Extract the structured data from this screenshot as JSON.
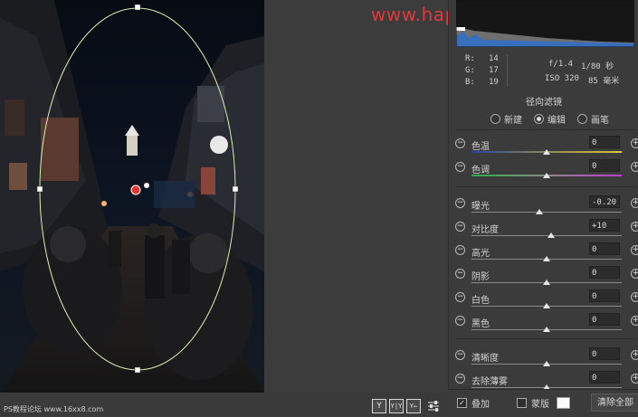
{
  "watermark": "www.happyjiansheji.com",
  "corner_watermark": "PS教程论坛 www.16xx8.com",
  "readout": {
    "r_label": "R:",
    "r_value": "14",
    "g_label": "G:",
    "g_value": "17",
    "b_label": "B:",
    "b_value": "19",
    "aperture": "f/1.4",
    "shutter": "1/80 秒",
    "iso": "ISO 320",
    "focal": "85 毫米"
  },
  "panel": {
    "title": "径向滤镜",
    "modes": [
      {
        "label": "新建",
        "selected": false
      },
      {
        "label": "编辑",
        "selected": true
      },
      {
        "label": "画笔",
        "selected": false
      }
    ],
    "sliders": [
      {
        "label": "色温",
        "value": "0",
        "position": 0.5,
        "track": "temp"
      },
      {
        "label": "色调",
        "value": "0",
        "position": 0.5,
        "track": "tint"
      },
      {
        "label": "曝光",
        "value": "-0.20",
        "position": 0.45,
        "track": "plain"
      },
      {
        "label": "对比度",
        "value": "+10",
        "position": 0.53,
        "track": "plain"
      },
      {
        "label": "高光",
        "value": "0",
        "position": 0.5,
        "track": "plain"
      },
      {
        "label": "阴影",
        "value": "0",
        "position": 0.5,
        "track": "plain"
      },
      {
        "label": "白色",
        "value": "0",
        "position": 0.5,
        "track": "plain"
      },
      {
        "label": "黑色",
        "value": "0",
        "position": 0.5,
        "track": "plain"
      },
      {
        "label": "清晰度",
        "value": "0",
        "position": 0.5,
        "track": "plain"
      },
      {
        "label": "去除薄雾",
        "value": "0",
        "position": 0.5,
        "track": "plain"
      }
    ]
  },
  "bottom": {
    "overlay_label": "叠加",
    "overlay_checked": true,
    "mask_label": "蒙版",
    "mask_checked": false,
    "clear_all_label": "清除全部"
  },
  "canvas_tools": [
    "Y",
    "Y|Y",
    "Y←",
    "sliders"
  ],
  "colors": {
    "watermark": "#e0393d",
    "ellipse": "#d8f0b0",
    "accent": "#e6e6e6"
  }
}
